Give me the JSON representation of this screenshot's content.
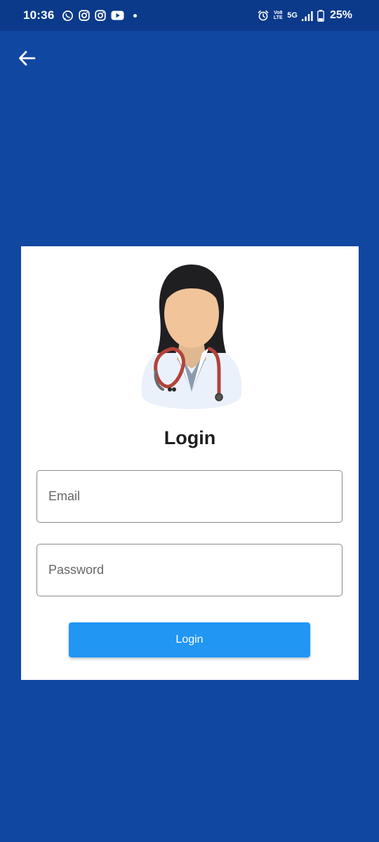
{
  "status_bar": {
    "time": "10:36",
    "left_icons": [
      "whatsapp-icon",
      "instagram-icon",
      "instagram-icon",
      "youtube-icon",
      "notification-dot"
    ],
    "volte_top": "Vo8",
    "volte_bottom": "LTE",
    "network": "5G",
    "battery": "25%"
  },
  "header": {
    "back_icon": "arrow-left-icon"
  },
  "login_card": {
    "avatar_icon": "doctor-avatar-icon",
    "title": "Login",
    "email_placeholder": "Email",
    "email_value": "",
    "password_placeholder": "Password",
    "password_value": "",
    "button_label": "Login"
  },
  "colors": {
    "background": "#0f47a1",
    "status_bar": "#0b3a8b",
    "card": "#ffffff",
    "button": "#2196f3",
    "title_text": "#1e1e1e"
  }
}
